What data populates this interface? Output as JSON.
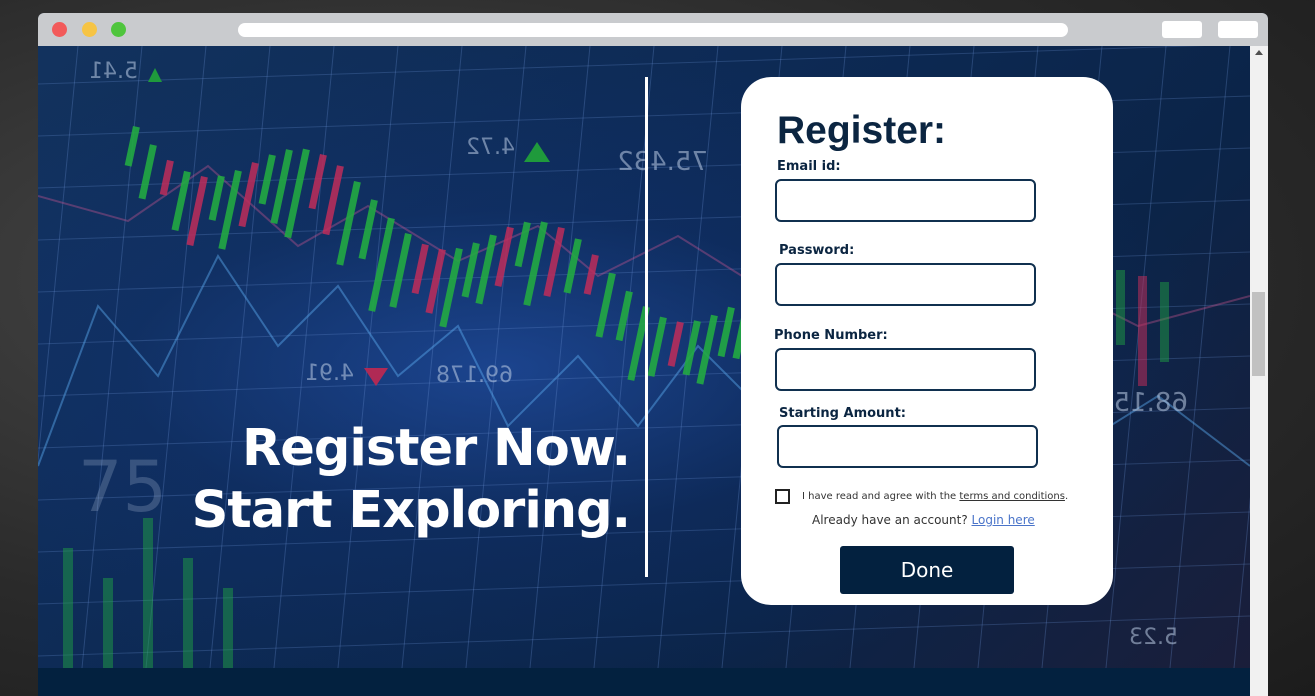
{
  "hero": {
    "headline_line1": "Register Now.",
    "headline_line2": "Start Exploring."
  },
  "form": {
    "title": "Register:",
    "email_label": "Email id:",
    "password_label": "Password:",
    "phone_label": "Phone Number:",
    "amount_label": "Starting Amount:",
    "email_value": "",
    "password_value": "",
    "phone_value": "",
    "amount_value": "",
    "terms_checked": false,
    "terms_prefix": "I have read and agree with the ",
    "terms_link": "terms and conditions",
    "terms_suffix": ".",
    "login_prefix": "Already have an account? ",
    "login_link": "Login here",
    "submit_label": "Done"
  },
  "background_numbers": [
    "5.41",
    "4.72",
    "75.432",
    "4.91",
    "69.178",
    "68.15",
    "5.23",
    "75"
  ],
  "colors": {
    "navy": "#03213f",
    "card_title": "#0b2541",
    "candle_green": "#1f9a3c",
    "candle_red": "#b02a55",
    "link_blue": "#4a74c9"
  }
}
